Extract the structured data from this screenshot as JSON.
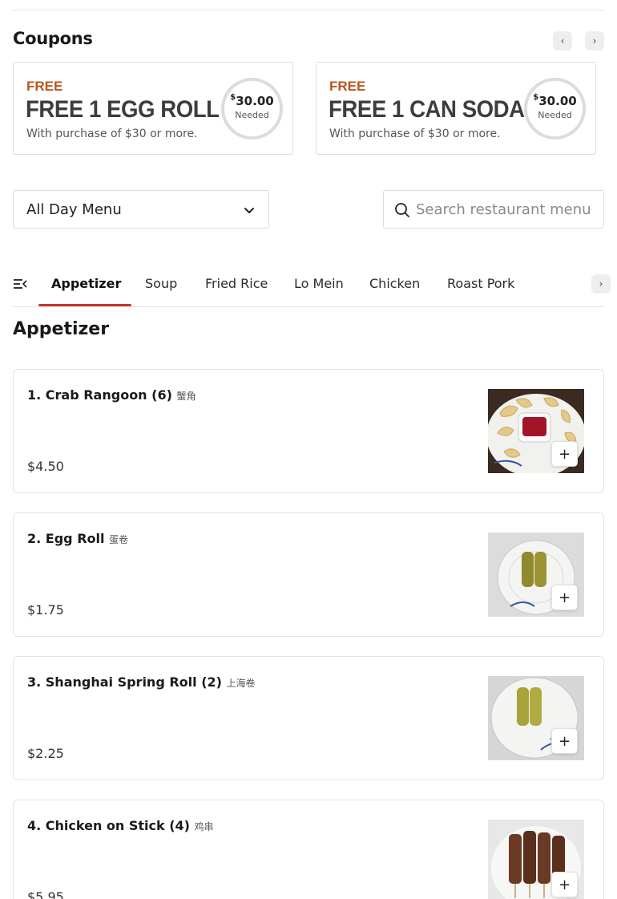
{
  "coupons": {
    "title": "Coupons",
    "prev_icon": "chevron-left-icon",
    "next_icon": "chevron-right-icon",
    "items": [
      {
        "tag": "FREE",
        "name": "FREE 1 EGG ROLL",
        "description": "With purchase of $30 or more.",
        "currency": "$",
        "amount": "30.00",
        "needed_label": "Needed"
      },
      {
        "tag": "FREE",
        "name": "FREE 1 CAN SODA",
        "description": "With purchase of $30 or more.",
        "currency": "$",
        "amount": "30.00",
        "needed_label": "Needed"
      }
    ],
    "tag_color": "#b8561e"
  },
  "menu_select": {
    "value": "All Day Menu",
    "icon": "chevron-down-icon"
  },
  "search": {
    "placeholder": "Search restaurant menu",
    "icon": "search-icon"
  },
  "categories": {
    "menu_icon": "category-list-icon",
    "active": "Appetizer",
    "tabs": [
      "Appetizer",
      "Soup",
      "Fried Rice",
      "Lo Mein",
      "Chicken",
      "Roast Pork"
    ],
    "next_icon": "chevron-right-icon",
    "accent": "#c9372c"
  },
  "section": {
    "title": "Appetizer"
  },
  "items": [
    {
      "name": "1. Crab Rangoon (6)",
      "cjk": "蟹角",
      "price": "$4.50",
      "add_label": "+"
    },
    {
      "name": "2. Egg Roll",
      "cjk": "蛋卷",
      "price": "$1.75",
      "add_label": "+"
    },
    {
      "name": "3. Shanghai Spring Roll (2)",
      "cjk": "上海卷",
      "price": "$2.25",
      "add_label": "+"
    },
    {
      "name": "4. Chicken on Stick (4)",
      "cjk": "鸡串",
      "price": "$5.95",
      "add_label": "+"
    }
  ]
}
